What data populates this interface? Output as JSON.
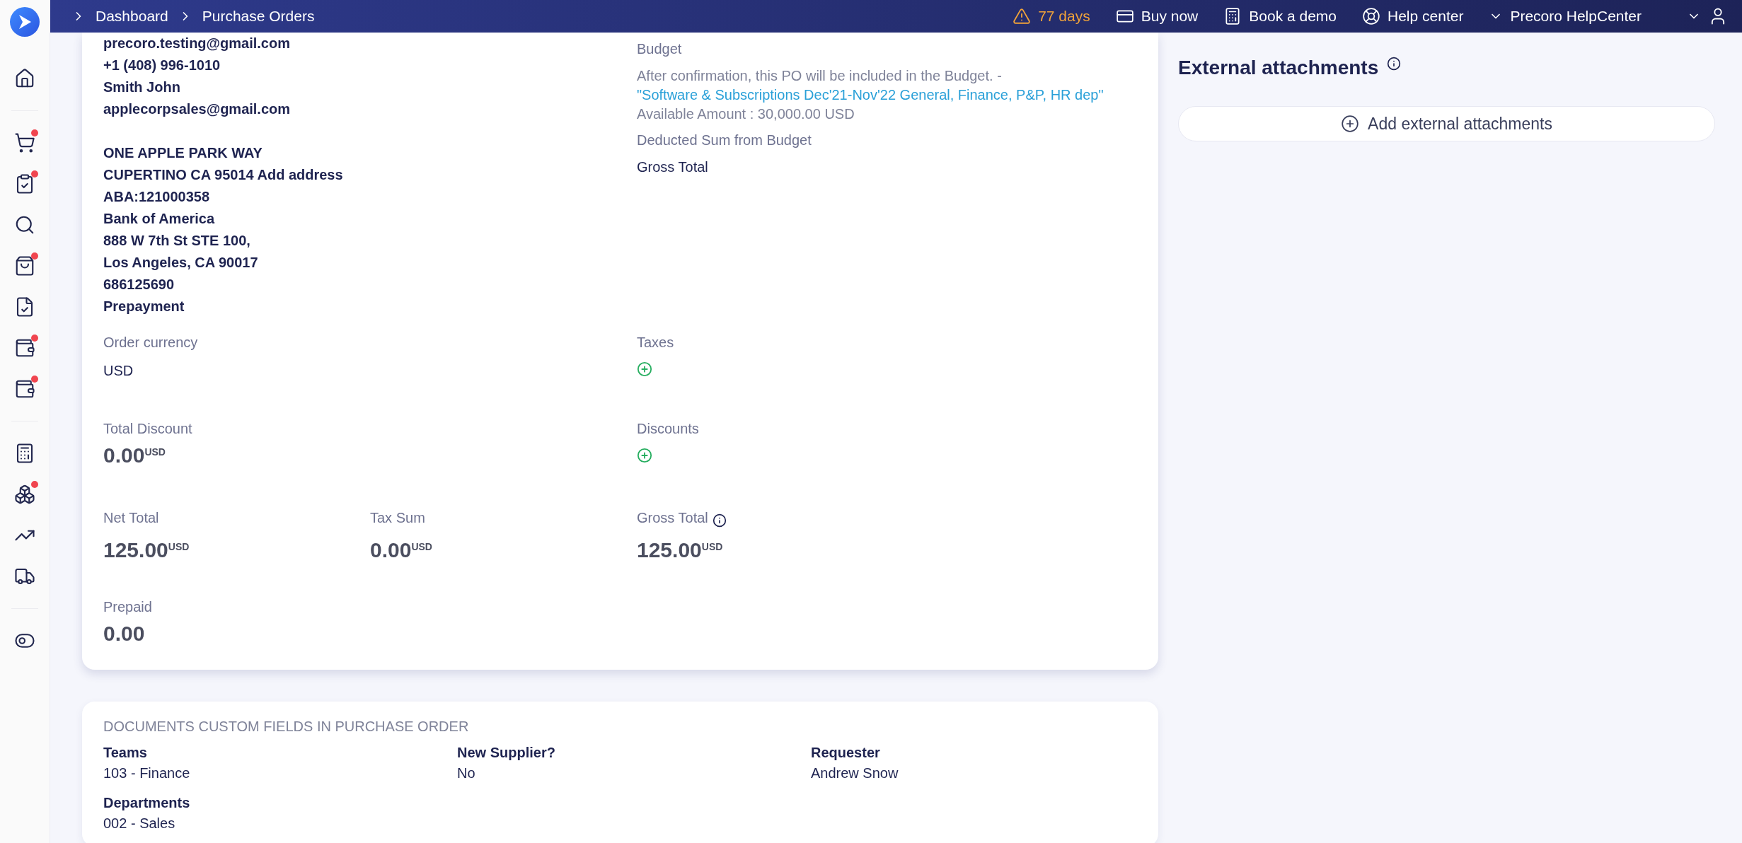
{
  "sidebar": {
    "items": [
      {
        "badge": false
      },
      {
        "badge": true
      },
      {
        "badge": true
      },
      {
        "badge": false
      },
      {
        "badge": true
      },
      {
        "badge": false
      },
      {
        "badge": true
      },
      {
        "badge": true
      },
      {
        "badge": false
      },
      {
        "badge": true
      },
      {
        "badge": false
      },
      {
        "badge": false
      },
      {
        "badge": false
      }
    ]
  },
  "header": {
    "breadcrumbs": [
      "Dashboard",
      "Purchase Orders"
    ],
    "trial": "77 days",
    "actions": [
      {
        "label": "Buy now"
      },
      {
        "label": "Book a demo"
      },
      {
        "label": "Help center"
      }
    ],
    "company": "Precoro HelpCenter"
  },
  "supplier_lines": [
    "precoro.testing@gmail.com",
    "+1 (408) 996-1010",
    "Smith John",
    "applecorpsales@gmail.com"
  ],
  "address_lines": [
    "ONE APPLE PARK WAY",
    "CUPERTINO CA 95014 Add address",
    "ABA:121000358",
    "Bank of America",
    "888 W 7th St STE 100,",
    "Los Angeles, CA 90017",
    "686125690",
    "Prepayment"
  ],
  "budget": {
    "label": "Budget",
    "note": "After confirmation, this PO will be included in the Budget. -",
    "link": "\"Software & Subscriptions Dec'21-Nov'22 General, Finance, P&P, HR dep\"",
    "available": "Available Amount : 30,000.00 USD",
    "deducted_label": "Deducted Sum from Budget",
    "deducted_value": "Gross Total"
  },
  "order_currency": {
    "label": "Order currency",
    "value": "USD"
  },
  "taxes": {
    "label": "Taxes"
  },
  "total_discount": {
    "label": "Total Discount",
    "value": "0.00",
    "currency": "USD"
  },
  "discounts": {
    "label": "Discounts"
  },
  "totals": [
    {
      "kind": "plain",
      "label": "Net Total",
      "value": "125.00",
      "currency": "USD"
    },
    {
      "kind": "plain",
      "label": "Tax Sum",
      "value": "0.00",
      "currency": "USD"
    },
    {
      "kind": "with_info",
      "label": "Gross Total",
      "value": "125.00",
      "currency": "USD"
    }
  ],
  "prepaid": {
    "label": "Prepaid",
    "value": "0.00"
  },
  "custom_fields": {
    "title": "DOCUMENTS CUSTOM FIELDS IN PURCHASE ORDER",
    "fields": [
      {
        "label": "Teams",
        "value": "103 - Finance"
      },
      {
        "label": "New Supplier?",
        "value": "No"
      },
      {
        "label": "Requester",
        "value": "Andrew Snow"
      },
      {
        "label": "Departments",
        "value": "002 - Sales"
      }
    ]
  },
  "attachments": {
    "title": "External attachments",
    "button": "Add external attachments"
  }
}
